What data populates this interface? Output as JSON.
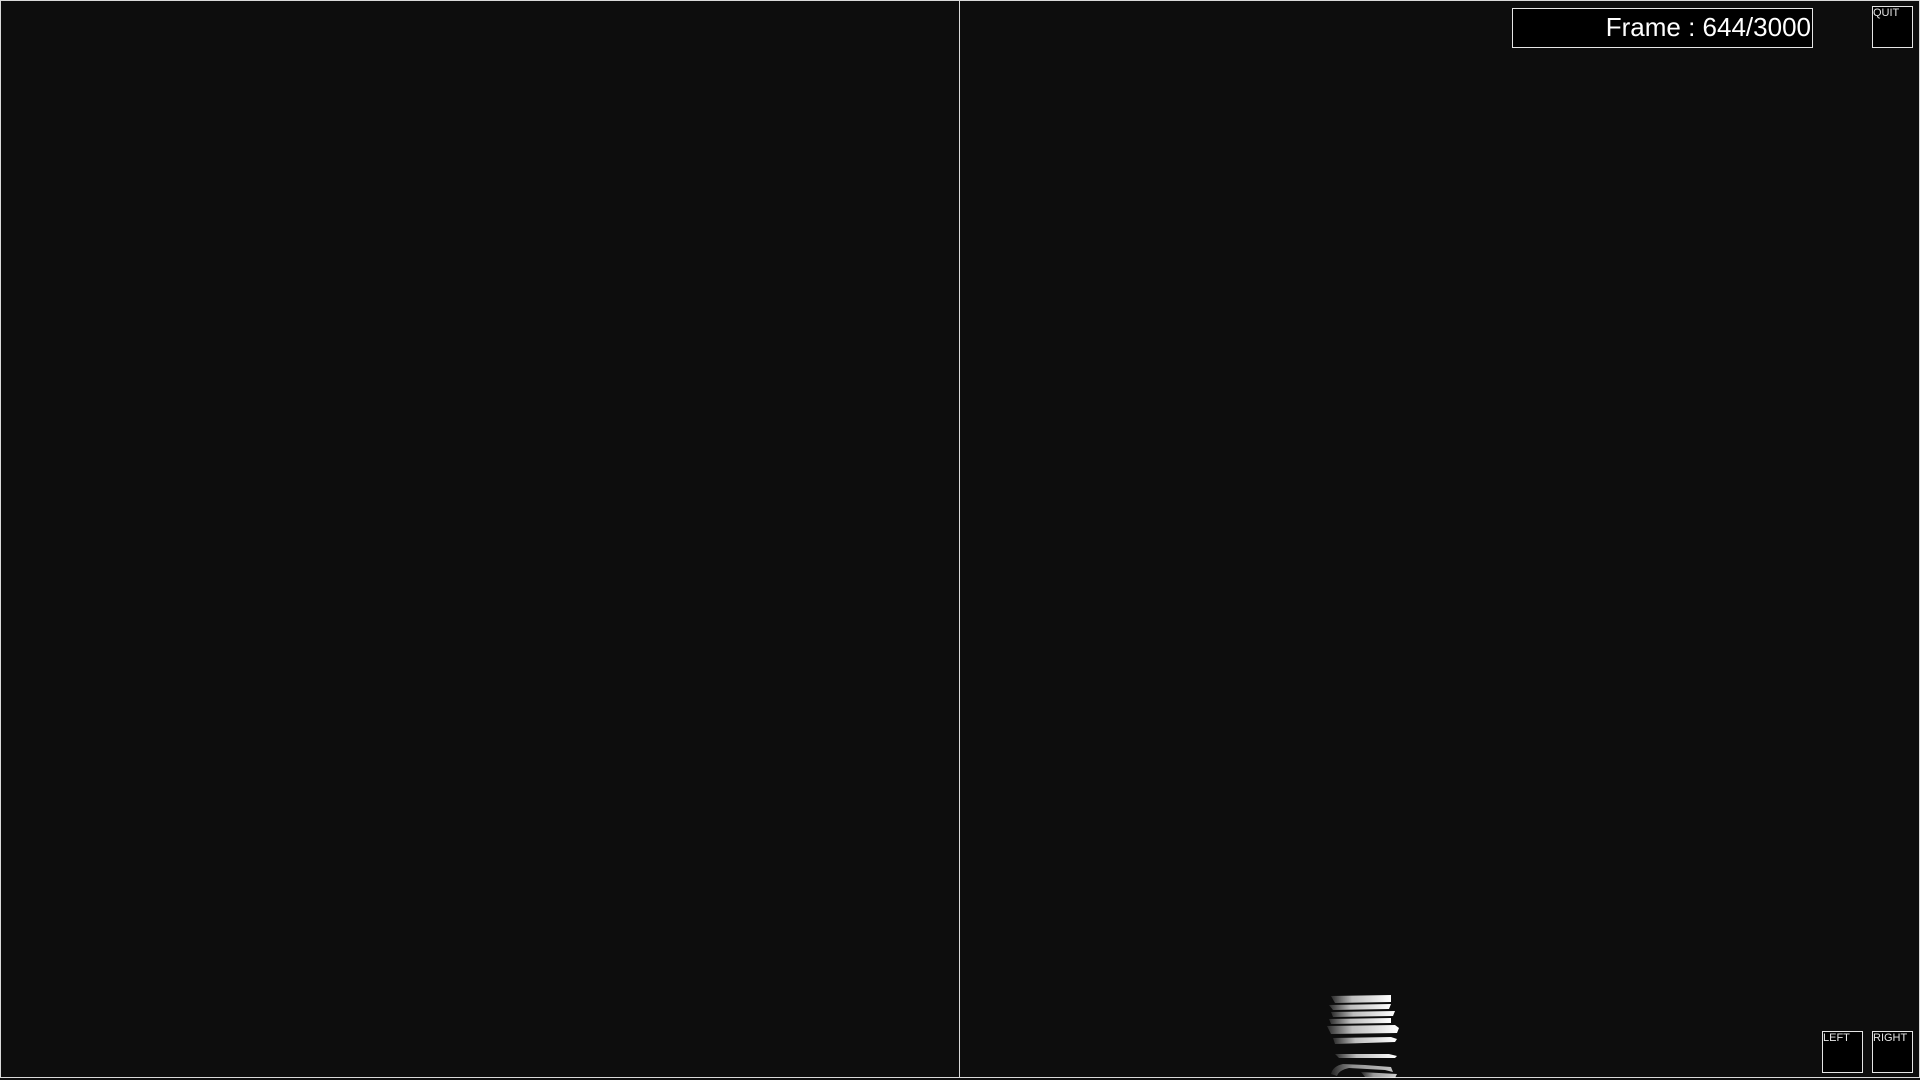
{
  "frame_counter": {
    "label": "Frame : 644/3000",
    "current": 644,
    "total": 3000
  },
  "buttons": {
    "quit": "QUIT",
    "left": "LEFT",
    "right": "RIGHT"
  },
  "colors": {
    "background": "#0d0d0d",
    "border": "#d9d9d9",
    "text": "#ffffff"
  }
}
